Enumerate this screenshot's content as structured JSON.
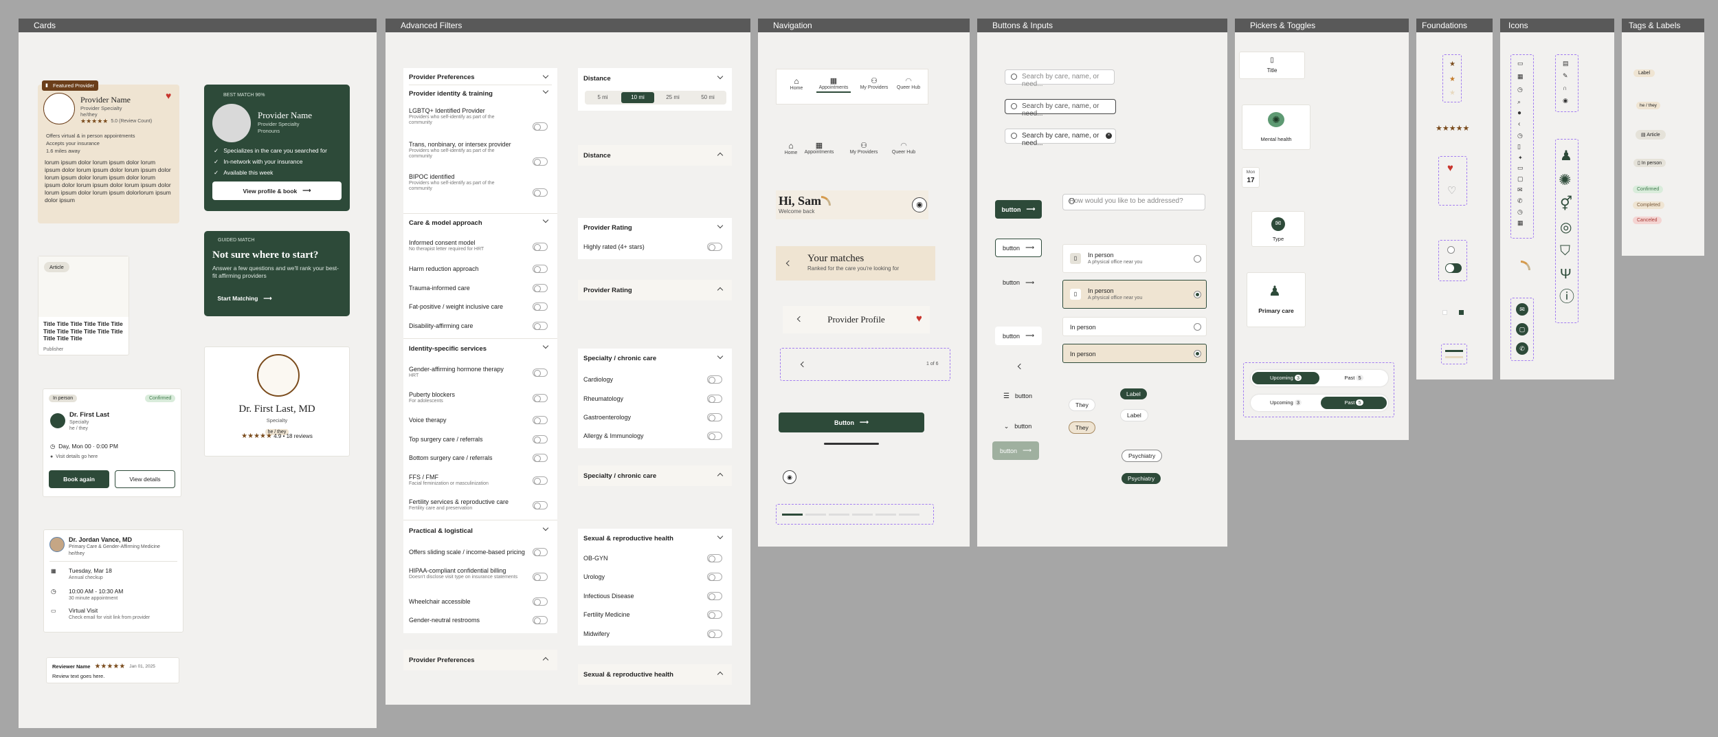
{
  "frames": {
    "cards": "Cards",
    "filters": "Advanced Filters",
    "navigation": "Navigation",
    "buttons": "Buttons & Inputs",
    "pickers": "Pickers & Toggles",
    "foundations": "Foundations",
    "icons": "Icons",
    "tags": "Tags & Labels"
  },
  "cards": {
    "featured_badge": "Featured Provider",
    "provider_name": "Provider Name",
    "provider_specialty": "Provider Specialty",
    "pronouns": "he/they",
    "rating_stars": "★★★★★",
    "review_count": "5.0 (Review Count)",
    "offers": "Offers virtual & in person appointments",
    "insurance": "Accepts your insurance",
    "distance": "1.6 miles away",
    "lorem": "lorum ipsum dolor lorum ipsum dolor lorum ipsum dolor lorum ipsum dolor lorum ipsum dolor lorum ipsum dolor lorum ipsum dolor lorum ipsum dolor lorum ipsum dolor lorum ipsum dolor lorum ipsum dolor lorum ipsum dolorlorum ipsum dolor ipsum",
    "best_match_label": "BEST MATCH 96%",
    "bm_name": "Provider Name",
    "bm_specialty": "Provider Specialty",
    "bm_pronouns": "Pronouns",
    "bm_check1": "Specializes in the care you searched for",
    "bm_check2": "In-network with your insurance",
    "bm_check3": "Available this week",
    "bm_button": "View profile & book",
    "article_tag": "Article",
    "article_title": "Title Title Title Title Title Title Title Title Title Title Title Title Title Title Title",
    "article_publisher": "Publisher",
    "guided_label": "GUIDED MATCH",
    "guided_title": "Not sure where to start?",
    "guided_body": "Answer a few questions and we'll rank your best-fit affirming providers",
    "guided_button": "Start Matching",
    "appt_type": "In person",
    "appt_status": "Confirmed",
    "appt_name": "Dr. First Last",
    "appt_specialty": "Specialty",
    "appt_pronouns": "he / they",
    "appt_time": "Day, Mon 00 · 0:00 PM",
    "appt_visit": "Visit details go here",
    "appt_book": "Book again",
    "appt_view": "View details",
    "profile_name": "Dr. First Last, MD",
    "profile_specialty": "Specialty",
    "profile_pronouns": "he / they",
    "profile_stars": "★★★★★",
    "profile_rating": "4.9 • 18 reviews",
    "detail_name": "Dr. Jordan Vance, MD",
    "detail_specialty": "Primary Care & Gender-Affirming Medicine",
    "detail_pronouns": "he/they",
    "detail_date": "Tuesday, Mar 18",
    "detail_date_sub": "Annual checkup",
    "detail_time": "10:00 AM - 10:30 AM",
    "detail_time_sub": "30 minute appointment",
    "detail_visit": "Virtual Visit",
    "detail_visit_sub": "Check email for visit link from provider",
    "review_name": "Reviewer Name",
    "review_stars": "★★★★★",
    "review_date": "Jan 01, 2025",
    "review_text": "Review text goes here."
  },
  "filters": {
    "provider_prefs": "Provider Preferences",
    "identity": "Provider identity & training",
    "lgbtq": "LGBTQ+ Identified Provider",
    "lgbtq_sub": "Providers who self-identify as part of the community",
    "trans": "Trans, nonbinary, or intersex provider",
    "trans_sub": "Providers who self-identify as part of the community",
    "bipoc": "BIPOC identified",
    "bipoc_sub": "Providers who self-identify as part of the community",
    "care_model": "Care & model approach",
    "informed": "Informed consent model",
    "informed_sub": "No therapist letter required for HRT",
    "harm": "Harm reduction approach",
    "trauma": "Trauma-informed care",
    "fat": "Fat-positive / weight inclusive care",
    "disability": "Disability-affirming care",
    "identity_services": "Identity-specific services",
    "gaht": "Gender-affirming hormone therapy",
    "gaht_sub": "HRT",
    "puberty": "Puberty blockers",
    "puberty_sub": "For adolescents",
    "voice": "Voice therapy",
    "top": "Top surgery care / referrals",
    "bottom": "Bottom surgery care / referrals",
    "ffs": "FFS / FMF",
    "ffs_sub": "Facial feminization or masculinization",
    "fertility": "Fertility services & reproductive care",
    "fertility_sub": "Fertility care and preservation",
    "practical": "Practical & logistical",
    "sliding": "Offers sliding scale / income-based pricing",
    "hipaa": "HIPAA-compliant confidential billing",
    "hipaa_sub": "Doesn't disclose visit type on insurance statements",
    "wheelchair": "Wheelchair accessible",
    "restrooms": "Gender-neutral restrooms",
    "provider_prefs_collapsed": "Provider Preferences",
    "distance": "Distance",
    "distance_opts": [
      "5 mi",
      "10 mi",
      "25 mi",
      "50 mi"
    ],
    "distance2": "Distance",
    "rating": "Provider Rating",
    "highly_rated": "Highly rated (4+ stars)",
    "rating2": "Provider Rating",
    "specialty": "Specialty / chronic care",
    "cardiology": "Cardiology",
    "rheumatology": "Rheumatology",
    "gastro": "Gastroenterology",
    "allergy": "Allergy & Immunology",
    "specialty2": "Specialty / chronic care",
    "sexual": "Sexual & reproductive health",
    "obgyn": "OB-GYN",
    "urology": "Urology",
    "infectious": "Infectious Disease",
    "fert_med": "Fertility Medicine",
    "midwifery": "Midwifery",
    "sexual2": "Sexual & reproductive health"
  },
  "nav": {
    "home": "Home",
    "appointments": "Appointments",
    "my_providers": "My Providers",
    "queer_hub": "Queer Hub",
    "greeting": "Hi, Sam",
    "welcome": "Welcome back",
    "matches_title": "Your matches",
    "matches_sub": "Ranked for the care you're looking for",
    "profile_title": "Provider Profile",
    "pager": "1 of 6",
    "button": "Button"
  },
  "buttons": {
    "search_placeholder": "Search by care, name, or need...",
    "address_placeholder": "How would you like to be addressed?",
    "button": "button",
    "in_person": "In person",
    "in_person_sub": "A physical office near you",
    "chip_they": "They",
    "chip_label": "Label",
    "chip_psych": "Psychiatry"
  },
  "pickers": {
    "title": "Title",
    "mental_health": "Mental health",
    "mon": "Mon",
    "day": "17",
    "type": "Type",
    "primary_care": "Primary care",
    "upcoming": "Upcoming",
    "past": "Past",
    "upcoming_count": "3",
    "past_count": "5",
    "past_count2": "5"
  },
  "tags": {
    "label": "Label",
    "he_they": "he / they",
    "article": "Article",
    "in_person": "In person",
    "confirmed": "Confirmed",
    "completed": "Completed",
    "canceled": "Canceled"
  },
  "colors": {
    "brand_green": "#2d4a39",
    "tan": "#efe4d2",
    "heart_red": "#c8352e",
    "accent_purple": "#a27cf0"
  }
}
